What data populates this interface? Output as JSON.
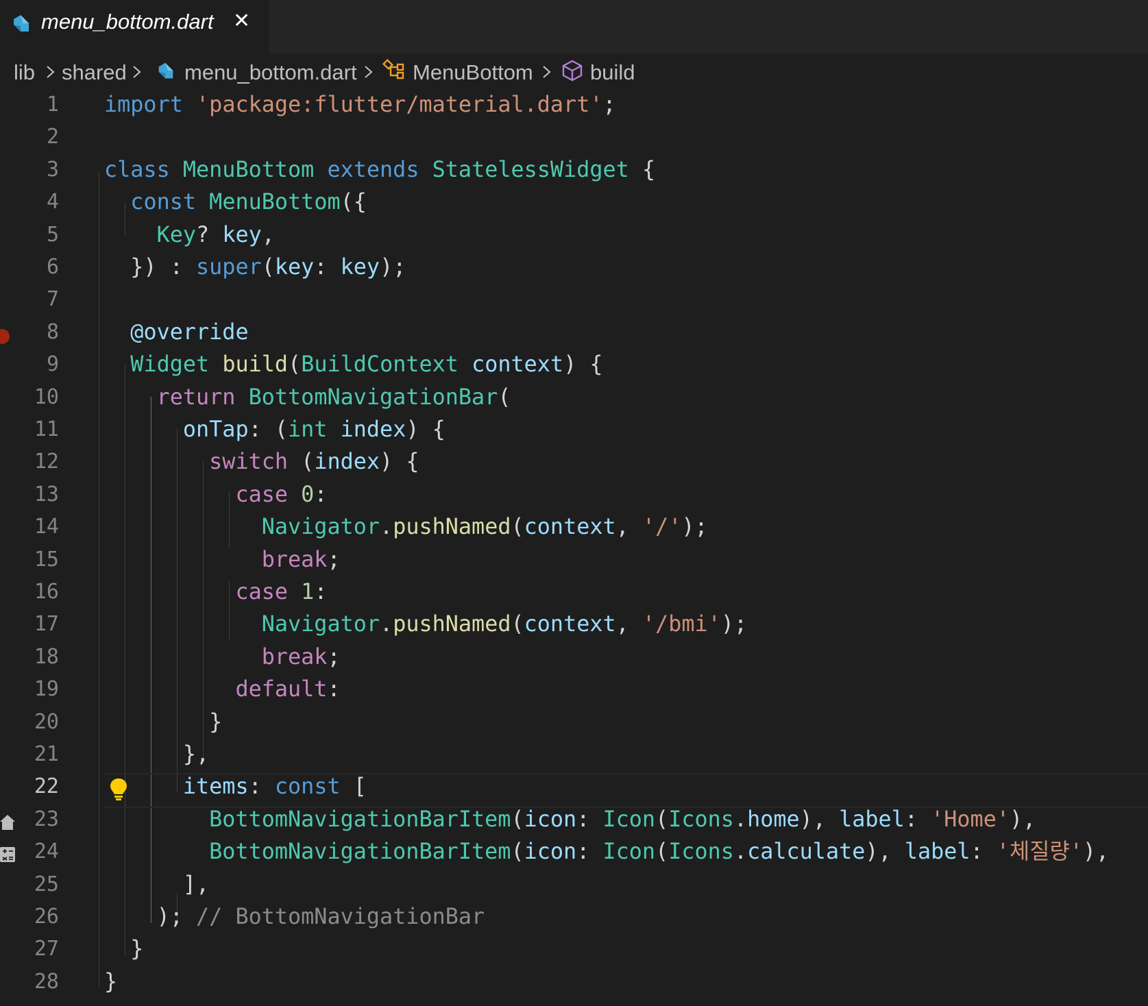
{
  "tab": {
    "filename": "menu_bottom.dart",
    "close_glyph": "✕",
    "icon": "dart-file-icon"
  },
  "breadcrumb": {
    "items": [
      "lib",
      "shared",
      "menu_bottom.dart",
      "MenuBottom",
      "build"
    ],
    "separator_icon": "chevron-right-icon"
  },
  "editor": {
    "active_line": 22,
    "breakpoint_line": 8,
    "lightbulb_line": 22,
    "gutter_icons": [
      {
        "line": 23,
        "icon": "home-icon"
      },
      {
        "line": 24,
        "icon": "calculate-icon"
      }
    ],
    "line_numbers": [
      "1",
      "2",
      "3",
      "4",
      "5",
      "6",
      "7",
      "8",
      "9",
      "10",
      "11",
      "12",
      "13",
      "14",
      "15",
      "16",
      "17",
      "18",
      "19",
      "20",
      "21",
      "22",
      "23",
      "24",
      "25",
      "26",
      "27",
      "28"
    ],
    "lines": [
      [
        {
          "t": "import",
          "c": "kw"
        },
        {
          "t": " ",
          "c": "pl"
        },
        {
          "t": "'package:flutter/material.dart'",
          "c": "st"
        },
        {
          "t": ";",
          "c": "pl"
        }
      ],
      [],
      [
        {
          "t": "class",
          "c": "kw"
        },
        {
          "t": " ",
          "c": "pl"
        },
        {
          "t": "MenuBottom",
          "c": "ty"
        },
        {
          "t": " ",
          "c": "pl"
        },
        {
          "t": "extends",
          "c": "kw"
        },
        {
          "t": " ",
          "c": "pl"
        },
        {
          "t": "StatelessWidget",
          "c": "ty"
        },
        {
          "t": " {",
          "c": "pl"
        }
      ],
      [
        {
          "t": "  ",
          "c": "pl"
        },
        {
          "t": "const",
          "c": "kw"
        },
        {
          "t": " ",
          "c": "pl"
        },
        {
          "t": "MenuBottom",
          "c": "ty"
        },
        {
          "t": "({",
          "c": "pl"
        }
      ],
      [
        {
          "t": "    ",
          "c": "pl"
        },
        {
          "t": "Key",
          "c": "ty"
        },
        {
          "t": "? ",
          "c": "pl"
        },
        {
          "t": "key",
          "c": "vr"
        },
        {
          "t": ",",
          "c": "pl"
        }
      ],
      [
        {
          "t": "  }) : ",
          "c": "pl"
        },
        {
          "t": "super",
          "c": "kw"
        },
        {
          "t": "(",
          "c": "pl"
        },
        {
          "t": "key",
          "c": "vr"
        },
        {
          "t": ": ",
          "c": "pl"
        },
        {
          "t": "key",
          "c": "vr"
        },
        {
          "t": ");",
          "c": "pl"
        }
      ],
      [],
      [
        {
          "t": "  ",
          "c": "pl"
        },
        {
          "t": "@override",
          "c": "vr"
        }
      ],
      [
        {
          "t": "  ",
          "c": "pl"
        },
        {
          "t": "Widget",
          "c": "ty"
        },
        {
          "t": " ",
          "c": "pl"
        },
        {
          "t": "build",
          "c": "fn"
        },
        {
          "t": "(",
          "c": "pl"
        },
        {
          "t": "BuildContext",
          "c": "ty"
        },
        {
          "t": " ",
          "c": "pl"
        },
        {
          "t": "context",
          "c": "vr"
        },
        {
          "t": ") {",
          "c": "pl"
        }
      ],
      [
        {
          "t": "    ",
          "c": "pl"
        },
        {
          "t": "return",
          "c": "ct"
        },
        {
          "t": " ",
          "c": "pl"
        },
        {
          "t": "BottomNavigationBar",
          "c": "ty"
        },
        {
          "t": "(",
          "c": "pl"
        }
      ],
      [
        {
          "t": "      ",
          "c": "pl"
        },
        {
          "t": "onTap",
          "c": "vr"
        },
        {
          "t": ": (",
          "c": "pl"
        },
        {
          "t": "int",
          "c": "ty"
        },
        {
          "t": " ",
          "c": "pl"
        },
        {
          "t": "index",
          "c": "vr"
        },
        {
          "t": ") {",
          "c": "pl"
        }
      ],
      [
        {
          "t": "        ",
          "c": "pl"
        },
        {
          "t": "switch",
          "c": "ct"
        },
        {
          "t": " (",
          "c": "pl"
        },
        {
          "t": "index",
          "c": "vr"
        },
        {
          "t": ") {",
          "c": "pl"
        }
      ],
      [
        {
          "t": "          ",
          "c": "pl"
        },
        {
          "t": "case",
          "c": "ct"
        },
        {
          "t": " ",
          "c": "pl"
        },
        {
          "t": "0",
          "c": "nu"
        },
        {
          "t": ":",
          "c": "pl"
        }
      ],
      [
        {
          "t": "            ",
          "c": "pl"
        },
        {
          "t": "Navigator",
          "c": "ty"
        },
        {
          "t": ".",
          "c": "pl"
        },
        {
          "t": "pushNamed",
          "c": "fn"
        },
        {
          "t": "(",
          "c": "pl"
        },
        {
          "t": "context",
          "c": "vr"
        },
        {
          "t": ", ",
          "c": "pl"
        },
        {
          "t": "'/'",
          "c": "st"
        },
        {
          "t": ");",
          "c": "pl"
        }
      ],
      [
        {
          "t": "            ",
          "c": "pl"
        },
        {
          "t": "break",
          "c": "ct"
        },
        {
          "t": ";",
          "c": "pl"
        }
      ],
      [
        {
          "t": "          ",
          "c": "pl"
        },
        {
          "t": "case",
          "c": "ct"
        },
        {
          "t": " ",
          "c": "pl"
        },
        {
          "t": "1",
          "c": "nu"
        },
        {
          "t": ":",
          "c": "pl"
        }
      ],
      [
        {
          "t": "            ",
          "c": "pl"
        },
        {
          "t": "Navigator",
          "c": "ty"
        },
        {
          "t": ".",
          "c": "pl"
        },
        {
          "t": "pushNamed",
          "c": "fn"
        },
        {
          "t": "(",
          "c": "pl"
        },
        {
          "t": "context",
          "c": "vr"
        },
        {
          "t": ", ",
          "c": "pl"
        },
        {
          "t": "'/bmi'",
          "c": "st"
        },
        {
          "t": ");",
          "c": "pl"
        }
      ],
      [
        {
          "t": "            ",
          "c": "pl"
        },
        {
          "t": "break",
          "c": "ct"
        },
        {
          "t": ";",
          "c": "pl"
        }
      ],
      [
        {
          "t": "          ",
          "c": "pl"
        },
        {
          "t": "default",
          "c": "ct"
        },
        {
          "t": ":",
          "c": "pl"
        }
      ],
      [
        {
          "t": "        }",
          "c": "pl"
        }
      ],
      [
        {
          "t": "      },",
          "c": "pl"
        }
      ],
      [
        {
          "t": "      ",
          "c": "pl"
        },
        {
          "t": "items",
          "c": "vr"
        },
        {
          "t": ": ",
          "c": "pl"
        },
        {
          "t": "const",
          "c": "kw"
        },
        {
          "t": " [",
          "c": "pl"
        }
      ],
      [
        {
          "t": "        ",
          "c": "pl"
        },
        {
          "t": "BottomNavigationBarItem",
          "c": "ty"
        },
        {
          "t": "(",
          "c": "pl"
        },
        {
          "t": "icon",
          "c": "vr"
        },
        {
          "t": ": ",
          "c": "pl"
        },
        {
          "t": "Icon",
          "c": "ty"
        },
        {
          "t": "(",
          "c": "pl"
        },
        {
          "t": "Icons",
          "c": "ty"
        },
        {
          "t": ".",
          "c": "pl"
        },
        {
          "t": "home",
          "c": "vr"
        },
        {
          "t": "), ",
          "c": "pl"
        },
        {
          "t": "label",
          "c": "vr"
        },
        {
          "t": ": ",
          "c": "pl"
        },
        {
          "t": "'Home'",
          "c": "st"
        },
        {
          "t": "),",
          "c": "pl"
        }
      ],
      [
        {
          "t": "        ",
          "c": "pl"
        },
        {
          "t": "BottomNavigationBarItem",
          "c": "ty"
        },
        {
          "t": "(",
          "c": "pl"
        },
        {
          "t": "icon",
          "c": "vr"
        },
        {
          "t": ": ",
          "c": "pl"
        },
        {
          "t": "Icon",
          "c": "ty"
        },
        {
          "t": "(",
          "c": "pl"
        },
        {
          "t": "Icons",
          "c": "ty"
        },
        {
          "t": ".",
          "c": "pl"
        },
        {
          "t": "calculate",
          "c": "vr"
        },
        {
          "t": "), ",
          "c": "pl"
        },
        {
          "t": "label",
          "c": "vr"
        },
        {
          "t": ": ",
          "c": "pl"
        },
        {
          "t": "'체질량'",
          "c": "st"
        },
        {
          "t": "),",
          "c": "pl"
        }
      ],
      [
        {
          "t": "      ],",
          "c": "pl"
        }
      ],
      [
        {
          "t": "    ); ",
          "c": "pl"
        },
        {
          "t": "// BottomNavigationBar",
          "c": "cmg"
        }
      ],
      [
        {
          "t": "  }",
          "c": "pl"
        }
      ],
      [
        {
          "t": "}",
          "c": "pl"
        }
      ]
    ]
  },
  "colors": {
    "background": "#1e1e1e",
    "keyword": "#569cd6",
    "control": "#c586c0",
    "type": "#4ec9b0",
    "function": "#dcdcaa",
    "variable": "#9cdcfe",
    "string": "#ce9178",
    "number": "#b5cea8",
    "breakpoint": "#a1260d",
    "lightbulb": "#ffcc00"
  }
}
